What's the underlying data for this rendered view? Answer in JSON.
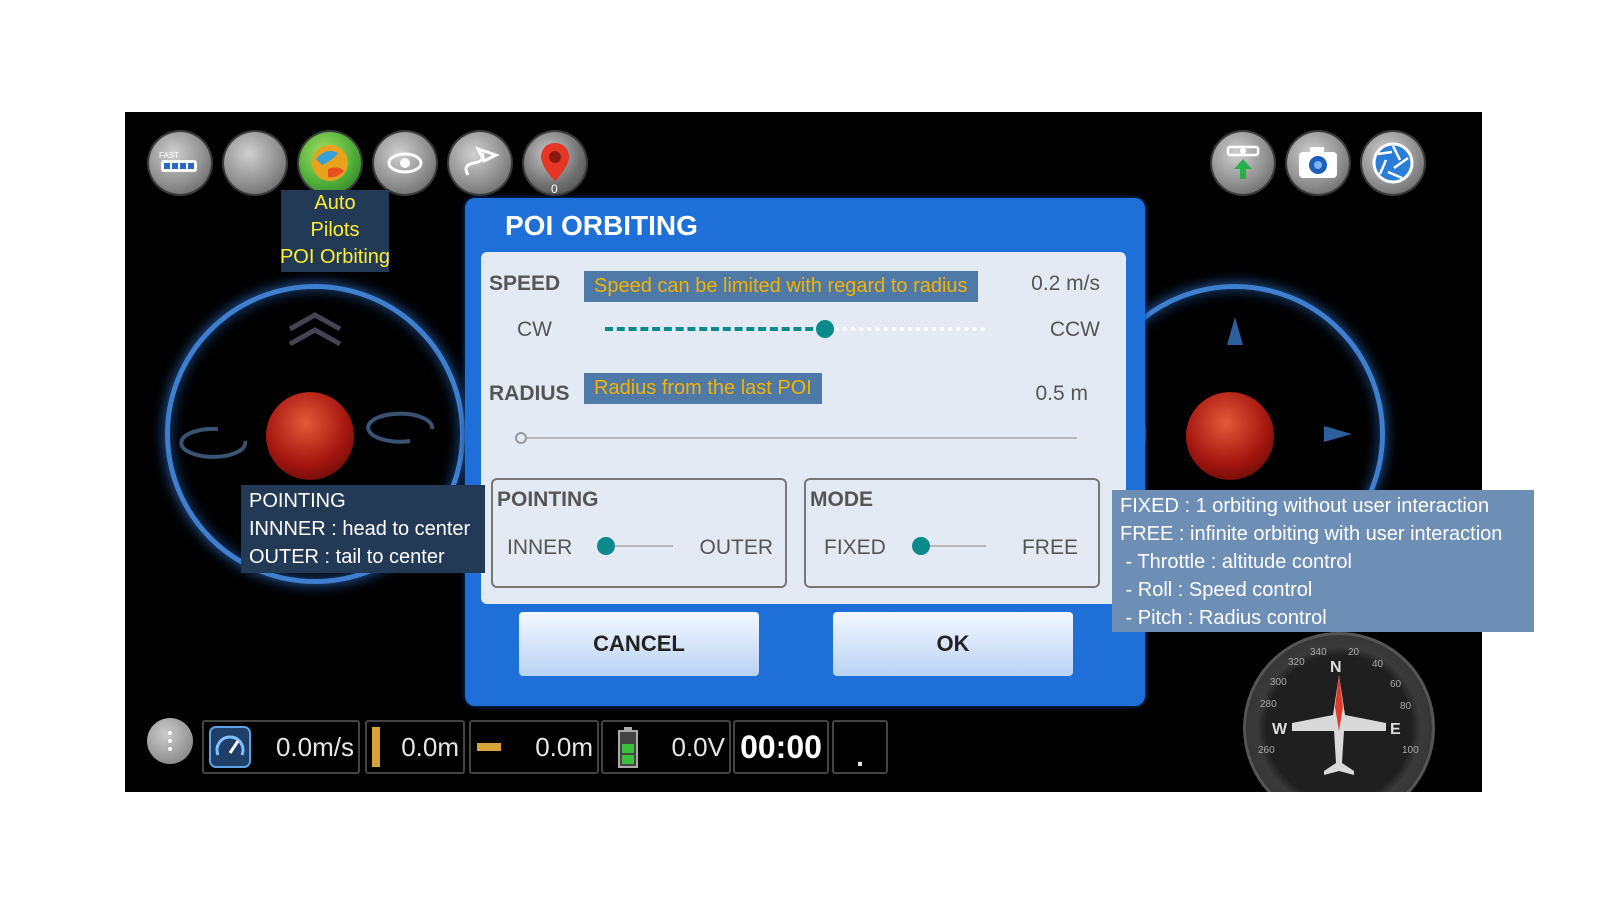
{
  "toolbar": {
    "left_icons": [
      "fast-battery-icon",
      "blank-circle-icon",
      "autopilot-globe-icon",
      "eye-icon",
      "send-route-icon",
      "location-pin-icon"
    ],
    "pin_count": "0",
    "right_icons": [
      "drone-takeoff-icon",
      "camera-icon",
      "shutter-icon"
    ]
  },
  "autopilot_label": [
    "Auto",
    "Pilots",
    "POI Orbiting"
  ],
  "dialog": {
    "title": "POI ORBITING",
    "speed": {
      "label": "SPEED",
      "value": "0.2 m/s",
      "left": "CW",
      "right": "CCW",
      "note": "Speed can be limited with regard to radius",
      "position": 0.58
    },
    "radius": {
      "label": "RADIUS",
      "value": "0.5 m",
      "note": "Radius from the last POI",
      "position": 0.0
    },
    "pointing": {
      "label": "POINTING",
      "left": "INNER",
      "right": "OUTER"
    },
    "mode": {
      "label": "MODE",
      "left": "FIXED",
      "right": "FREE"
    },
    "cancel": "CANCEL",
    "ok": "OK"
  },
  "status": {
    "speed": "0.0m/s",
    "altitude": "0.0m",
    "distance": "0.0m",
    "voltage": "0.0V",
    "time": "00:00",
    "dot": "."
  },
  "compass": {
    "n": "N",
    "e": "E",
    "w": "W",
    "ticks": [
      "20",
      "40",
      "60",
      "80",
      "100",
      "340",
      "320",
      "300",
      "280",
      "260"
    ]
  },
  "annotations": {
    "pointing": [
      "POINTING",
      "INNNER : head to center",
      "OUTER   : tail to center"
    ],
    "mode": [
      "FIXED : 1 orbiting without user interaction",
      "FREE : infinite orbiting with user interaction",
      " - Throttle : altitude control",
      " - Roll : Speed control",
      " - Pitch : Radius control"
    ]
  },
  "colors": {
    "dialog": "#1e6fd8",
    "slider": "#0b8a8c",
    "note_text": "#f5b300",
    "annotation_bg": "#233a57"
  }
}
